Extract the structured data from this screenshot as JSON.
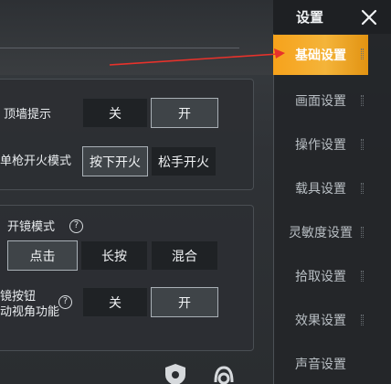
{
  "sidebar": {
    "title": "设置",
    "items": [
      {
        "label": "基础设置",
        "active": true
      },
      {
        "label": "画面设置",
        "active": false
      },
      {
        "label": "操作设置",
        "active": false
      },
      {
        "label": "载具设置",
        "active": false
      },
      {
        "label": "灵敏度设置",
        "active": false
      },
      {
        "label": "拾取设置",
        "active": false
      },
      {
        "label": "效果设置",
        "active": false
      },
      {
        "label": "声音设置",
        "active": false
      }
    ]
  },
  "settings": {
    "wall_hint": {
      "label": "顶墙提示",
      "options": [
        "关",
        "开"
      ],
      "selected": "开"
    },
    "fire_mode": {
      "label": "单枪开火模式",
      "options": [
        "按下开火",
        "松手开火"
      ],
      "selected": "按下开火"
    },
    "scope_mode": {
      "label": "开镜模式",
      "options": [
        "点击",
        "长按",
        "混合"
      ],
      "selected": "点击"
    },
    "button_view": {
      "label_line1": "镜按钮",
      "label_line2": "动视角功能",
      "options": [
        "关",
        "开"
      ],
      "selected": "开"
    }
  },
  "colors": {
    "accent": "#f7a21b",
    "annotation_arrow": "#e8322b",
    "selected_border": "#a9b0b6"
  },
  "icons": [
    "help-icon",
    "close-icon",
    "shield-icon",
    "headset-icon"
  ]
}
